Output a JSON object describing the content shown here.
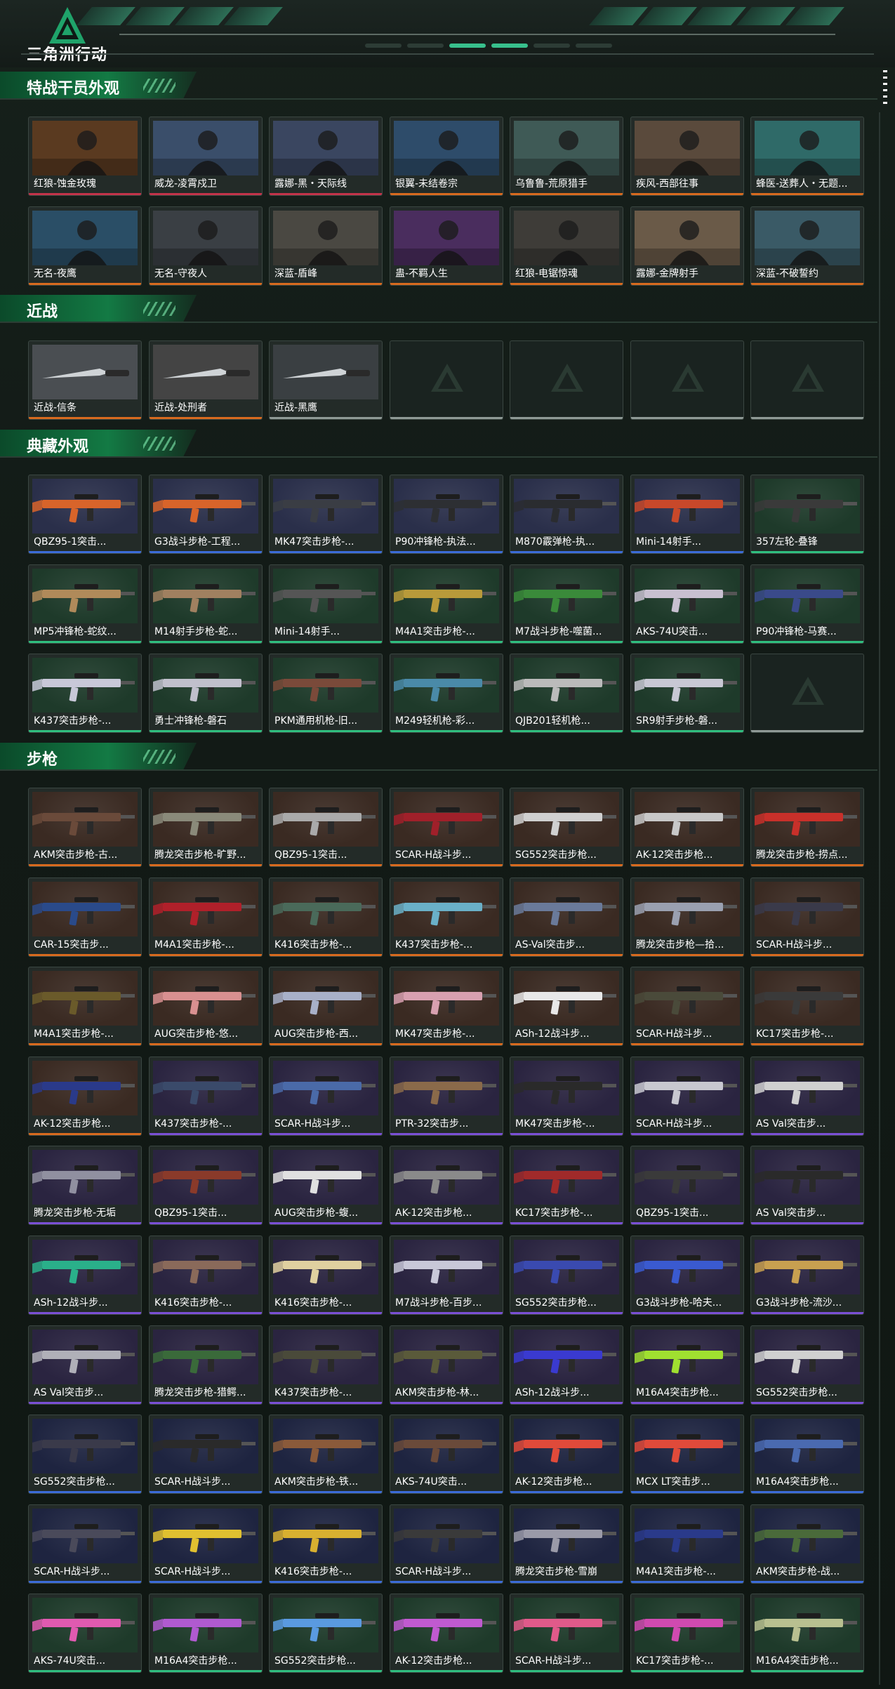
{
  "header": {
    "logo_text": "三角洲行动"
  },
  "colors": {
    "orange": "#d86a1e",
    "red": "#c2334a",
    "gray": "#8f9a96",
    "blue": "#3b6bd8",
    "green": "#2fbf7f",
    "purple": "#7a4fd6",
    "accent": "#1e8a4e"
  },
  "sections": [
    {
      "id": "operators",
      "title": "特战干员外观",
      "items": [
        {
          "name": "红狼-蚀金玫瑰",
          "rarity": "red",
          "tint": "#5a3a20"
        },
        {
          "name": "威龙-凌霄戍卫",
          "rarity": "red",
          "tint": "#3a4e6a"
        },
        {
          "name": "露娜-黑・天际线",
          "rarity": "red",
          "tint": "#3a4660"
        },
        {
          "name": "银翼-未结卷宗",
          "rarity": "orange",
          "tint": "#2e4c6a"
        },
        {
          "name": "乌鲁鲁-荒原猎手",
          "rarity": "orange",
          "tint": "#3f5a56"
        },
        {
          "name": "疾风-西部往事",
          "rarity": "orange",
          "tint": "#5a4a3c"
        },
        {
          "name": "蜂医-送葬人・无题...",
          "rarity": "orange",
          "tint": "#2f6a68"
        },
        {
          "name": "无名-夜鹰",
          "rarity": "orange",
          "tint": "#2a4e66"
        },
        {
          "name": "无名-守夜人",
          "rarity": "orange",
          "tint": "#3a3f44"
        },
        {
          "name": "深蓝-盾峰",
          "rarity": "orange",
          "tint": "#4a4842"
        },
        {
          "name": "蛊-不羁人生",
          "rarity": "orange",
          "tint": "#4a2d5e"
        },
        {
          "name": "红狼-电锯惊魂",
          "rarity": "orange",
          "tint": "#3e3c38"
        },
        {
          "name": "露娜-金牌射手",
          "rarity": "orange",
          "tint": "#6a5a48"
        },
        {
          "name": "深蓝-不破誓约",
          "rarity": "orange",
          "tint": "#3a5a66"
        }
      ]
    },
    {
      "id": "melee",
      "title": "近战",
      "items": [
        {
          "name": "近战-信条",
          "rarity": "orange",
          "tint": "#4a4e52"
        },
        {
          "name": "近战-处刑者",
          "rarity": "orange",
          "tint": "#444"
        },
        {
          "name": "近战-黑鹰",
          "rarity": "gray",
          "tint": "#3a3f42"
        },
        {
          "name": "",
          "rarity": "gray",
          "empty": true
        },
        {
          "name": "",
          "rarity": "gray",
          "empty": true
        },
        {
          "name": "",
          "rarity": "gray",
          "empty": true
        },
        {
          "name": "",
          "rarity": "gray",
          "empty": true
        }
      ]
    },
    {
      "id": "collection",
      "title": "典藏外观",
      "items": [
        {
          "name": "QBZ95-1突击...",
          "rarity": "blue",
          "gun": "#d8642a",
          "tint": "#2a2f4a"
        },
        {
          "name": "G3战斗步枪-工程...",
          "rarity": "blue",
          "gun": "#d8642a",
          "tint": "#2a2f4a"
        },
        {
          "name": "MK47突击步枪-...",
          "rarity": "blue",
          "gun": "#3a3d44",
          "tint": "#2a2f4a"
        },
        {
          "name": "P90冲锋枪-执法...",
          "rarity": "blue",
          "gun": "#2d2f33",
          "tint": "#2a2f4a"
        },
        {
          "name": "M870霰弹枪-执...",
          "rarity": "blue",
          "gun": "#2a2c30",
          "tint": "#2a2f4a"
        },
        {
          "name": "Mini-14射手...",
          "rarity": "blue",
          "gun": "#c8482a",
          "tint": "#2a2f4a"
        },
        {
          "name": "357左轮-叠锋",
          "rarity": "green",
          "gun": "#3a3a3a",
          "tint": "#1e3a2a"
        },
        {
          "name": "MP5冲锋枪-蛇纹...",
          "rarity": "green",
          "gun": "#b08a5a",
          "tint": "#1e3a2a"
        },
        {
          "name": "M14射手步枪-蛇...",
          "rarity": "green",
          "gun": "#a08060",
          "tint": "#1e3a2a"
        },
        {
          "name": "Mini-14射手...",
          "rarity": "green",
          "gun": "#555",
          "tint": "#1e3a2a"
        },
        {
          "name": "M4A1突击步枪-...",
          "rarity": "green",
          "gun": "#b89a3a",
          "tint": "#1e3a2a"
        },
        {
          "name": "M7战斗步枪-噬菌...",
          "rarity": "green",
          "gun": "#3a8a3a",
          "tint": "#1e3a2a"
        },
        {
          "name": "AKS-74U突击...",
          "rarity": "green",
          "gun": "#c8c0d0",
          "tint": "#1e3a2a"
        },
        {
          "name": "P90冲锋枪-马赛...",
          "rarity": "green",
          "gun": "#3a4a8a",
          "tint": "#1e3a2a"
        },
        {
          "name": "K437突击步枪-...",
          "rarity": "green",
          "gun": "#c8c8d8",
          "tint": "#1e3a2a"
        },
        {
          "name": "勇士冲锋枪-磐石",
          "rarity": "green",
          "gun": "#c0c0cc",
          "tint": "#1e3a2a"
        },
        {
          "name": "PKM通用机枪-旧...",
          "rarity": "green",
          "gun": "#7a4a3a",
          "tint": "#1e3a2a"
        },
        {
          "name": "M249轻机枪-彩...",
          "rarity": "green",
          "gun": "#4a8aa8",
          "tint": "#1e3a2a"
        },
        {
          "name": "QJB201轻机枪...",
          "rarity": "green",
          "gun": "#bbb",
          "tint": "#1e3a2a"
        },
        {
          "name": "SR9射手步枪-磐...",
          "rarity": "green",
          "gun": "#c8c8d4",
          "tint": "#1e3a2a"
        },
        {
          "name": "",
          "rarity": "gray",
          "empty": true
        }
      ]
    },
    {
      "id": "rifles",
      "title": "步枪",
      "items": [
        {
          "name": "AKM突击步枪-古...",
          "rarity": "orange",
          "gun": "#6a4a3a",
          "tint": "#3a2a22"
        },
        {
          "name": "腾龙突击步枪-旷野...",
          "rarity": "orange",
          "gun": "#8a8a7a",
          "tint": "#3a2a22"
        },
        {
          "name": "QBZ95-1突击...",
          "rarity": "orange",
          "gun": "#aaa",
          "tint": "#3a2a22"
        },
        {
          "name": "SCAR-H战斗步...",
          "rarity": "orange",
          "gun": "#a0202a",
          "tint": "#3a2a22"
        },
        {
          "name": "SG552突击步枪...",
          "rarity": "orange",
          "gun": "#d0d0d0",
          "tint": "#3a2a22"
        },
        {
          "name": "AK-12突击步枪...",
          "rarity": "orange",
          "gun": "#c8c8c8",
          "tint": "#3a2a22"
        },
        {
          "name": "腾龙突击步枪-捞点...",
          "rarity": "orange",
          "gun": "#c8302a",
          "tint": "#3a2a22"
        },
        {
          "name": "CAR-15突击步...",
          "rarity": "orange",
          "gun": "#2a4a8a",
          "tint": "#3a2a22"
        },
        {
          "name": "M4A1突击步枪-...",
          "rarity": "orange",
          "gun": "#b0202a",
          "tint": "#3a2a22"
        },
        {
          "name": "K416突击步枪-...",
          "rarity": "orange",
          "gun": "#4a6a5a",
          "tint": "#3a2a22"
        },
        {
          "name": "K437突击步枪-...",
          "rarity": "orange",
          "gun": "#6ab0c8",
          "tint": "#3a2a22"
        },
        {
          "name": "AS-Val突击步...",
          "rarity": "orange",
          "gun": "#6a7a9a",
          "tint": "#3a2a22"
        },
        {
          "name": "腾龙突击步枪—拾...",
          "rarity": "orange",
          "gun": "#9aa0b0",
          "tint": "#3a2a22"
        },
        {
          "name": "SCAR-H战斗步...",
          "rarity": "orange",
          "gun": "#3a3a4a",
          "tint": "#3a2a22"
        },
        {
          "name": "M4A1突击步枪-...",
          "rarity": "orange",
          "gun": "#6a5a2a",
          "tint": "#3a2a22"
        },
        {
          "name": "AUG突击步枪-悠...",
          "rarity": "orange",
          "gun": "#d89090",
          "tint": "#3a2a22"
        },
        {
          "name": "AUG突击步枪-西...",
          "rarity": "orange",
          "gun": "#a8b0c8",
          "tint": "#3a2a22"
        },
        {
          "name": "MK47突击步枪-...",
          "rarity": "orange",
          "gun": "#d8a0b0",
          "tint": "#3a2a22"
        },
        {
          "name": "ASh-12战斗步...",
          "rarity": "orange",
          "gun": "#e8e8e8",
          "tint": "#3a2a22"
        },
        {
          "name": "SCAR-H战斗步...",
          "rarity": "orange",
          "gun": "#4a4a3a",
          "tint": "#3a2a22"
        },
        {
          "name": "KC17突击步枪-...",
          "rarity": "orange",
          "gun": "#3a3a3a",
          "tint": "#3a2a22"
        },
        {
          "name": "AK-12突击步枪...",
          "rarity": "orange",
          "gun": "#2a3a8a",
          "tint": "#3a2a22"
        },
        {
          "name": "K437突击步枪-...",
          "rarity": "purple",
          "gun": "#3a4a6a",
          "tint": "#2a2440"
        },
        {
          "name": "SCAR-H战斗步...",
          "rarity": "purple",
          "gun": "#4a6aa8",
          "tint": "#2a2440"
        },
        {
          "name": "PTR-32突击步...",
          "rarity": "purple",
          "gun": "#8a6a4a",
          "tint": "#2a2440"
        },
        {
          "name": "MK47突击步枪-...",
          "rarity": "purple",
          "gun": "#2a2a2a",
          "tint": "#2a2440"
        },
        {
          "name": "SCAR-H战斗步...",
          "rarity": "purple",
          "gun": "#c8c8d0",
          "tint": "#2a2440"
        },
        {
          "name": "AS Val突击步...",
          "rarity": "purple",
          "gun": "#d0d0d0",
          "tint": "#2a2440"
        },
        {
          "name": "腾龙突击步枪-无垢",
          "rarity": "purple",
          "gun": "#9090a0",
          "tint": "#2a2440"
        },
        {
          "name": "QBZ95-1突击...",
          "rarity": "purple",
          "gun": "#8a3a2a",
          "tint": "#2a2440"
        },
        {
          "name": "AUG突击步枪-蝮...",
          "rarity": "purple",
          "gun": "#e0e0e0",
          "tint": "#2a2440"
        },
        {
          "name": "AK-12突击步枪...",
          "rarity": "purple",
          "gun": "#8a8a8a",
          "tint": "#2a2440"
        },
        {
          "name": "KC17突击步枪-...",
          "rarity": "purple",
          "gun": "#a02a2a",
          "tint": "#2a2440"
        },
        {
          "name": "QBZ95-1突击...",
          "rarity": "purple",
          "gun": "#3a3a3a",
          "tint": "#2a2440"
        },
        {
          "name": "AS Val突击步...",
          "rarity": "purple",
          "gun": "#2a2a2a",
          "tint": "#2a2440"
        },
        {
          "name": "ASh-12战斗步...",
          "rarity": "purple",
          "gun": "#2ab08a",
          "tint": "#2a2440"
        },
        {
          "name": "K416突击步枪-...",
          "rarity": "purple",
          "gun": "#8a6a5a",
          "tint": "#2a2440"
        },
        {
          "name": "K416突击步枪-...",
          "rarity": "purple",
          "gun": "#e0d0a0",
          "tint": "#2a2440"
        },
        {
          "name": "M7战斗步枪-百步...",
          "rarity": "purple",
          "gun": "#c8c8d8",
          "tint": "#2a2440"
        },
        {
          "name": "SG552突击步枪...",
          "rarity": "purple",
          "gun": "#3a4ab0",
          "tint": "#2a2440"
        },
        {
          "name": "G3战斗步枪-哈夫...",
          "rarity": "purple",
          "gun": "#3a5ad0",
          "tint": "#2a2440"
        },
        {
          "name": "G3战斗步枪-流沙...",
          "rarity": "purple",
          "gun": "#c8a050",
          "tint": "#2a2440"
        },
        {
          "name": "AS Val突击步...",
          "rarity": "purple",
          "gun": "#b0b0b8",
          "tint": "#2a2440"
        },
        {
          "name": "腾龙突击步枪-猎鳄...",
          "rarity": "purple",
          "gun": "#3a6a3a",
          "tint": "#2a2440"
        },
        {
          "name": "K437突击步枪-...",
          "rarity": "purple",
          "gun": "#4a4a3a",
          "tint": "#2a2440"
        },
        {
          "name": "AKM突击步枪-林...",
          "rarity": "purple",
          "gun": "#5a5a3a",
          "tint": "#2a2440"
        },
        {
          "name": "ASh-12战斗步...",
          "rarity": "purple",
          "gun": "#3a3ad0",
          "tint": "#2a2440"
        },
        {
          "name": "M16A4突击步枪...",
          "rarity": "purple",
          "gun": "#a0e030",
          "tint": "#2a2440"
        },
        {
          "name": "SG552突击步枪...",
          "rarity": "purple",
          "gun": "#d0d0d0",
          "tint": "#2a2440"
        },
        {
          "name": "SG552突击步枪...",
          "rarity": "blue",
          "gun": "#3a3a4a",
          "tint": "#1e2440"
        },
        {
          "name": "SCAR-H战斗步...",
          "rarity": "blue",
          "gun": "#2a2a2a",
          "tint": "#1e2440"
        },
        {
          "name": "AKM突击步枪-铁...",
          "rarity": "blue",
          "gun": "#8a5a3a",
          "tint": "#1e2440"
        },
        {
          "name": "AKS-74U突击...",
          "rarity": "blue",
          "gun": "#6a4a3a",
          "tint": "#1e2440"
        },
        {
          "name": "AK-12突击步枪...",
          "rarity": "blue",
          "gun": "#e04a3a",
          "tint": "#1e2440"
        },
        {
          "name": "MCX LT突击步...",
          "rarity": "blue",
          "gun": "#e04a3a",
          "tint": "#1e2440"
        },
        {
          "name": "M16A4突击步枪...",
          "rarity": "blue",
          "gun": "#4a6ab0",
          "tint": "#1e2440"
        },
        {
          "name": "SCAR-H战斗步...",
          "rarity": "blue",
          "gun": "#4a4a5a",
          "tint": "#1e2440"
        },
        {
          "name": "SCAR-H战斗步...",
          "rarity": "blue",
          "gun": "#e0c030",
          "tint": "#1e2440"
        },
        {
          "name": "K416突击步枪-...",
          "rarity": "blue",
          "gun": "#d8b030",
          "tint": "#1e2440"
        },
        {
          "name": "SCAR-H战斗步...",
          "rarity": "blue",
          "gun": "#3a3a3a",
          "tint": "#1e2440"
        },
        {
          "name": "腾龙突击步枪-雪崩",
          "rarity": "blue",
          "gun": "#9a9aa8",
          "tint": "#1e2440"
        },
        {
          "name": "M4A1突击步枪-...",
          "rarity": "blue",
          "gun": "#2a3a8a",
          "tint": "#1e2440"
        },
        {
          "name": "AKM突击步枪-战...",
          "rarity": "blue",
          "gun": "#4a6a3a",
          "tint": "#1e2440"
        },
        {
          "name": "AKS-74U突击...",
          "rarity": "green",
          "gun": "#e05ab0",
          "tint": "#1e3a2a"
        },
        {
          "name": "M16A4突击步枪...",
          "rarity": "green",
          "gun": "#b05ad0",
          "tint": "#1e3a2a"
        },
        {
          "name": "SG552突击步枪...",
          "rarity": "green",
          "gun": "#5a9ae0",
          "tint": "#1e3a2a"
        },
        {
          "name": "AK-12突击步枪...",
          "rarity": "green",
          "gun": "#c05ad0",
          "tint": "#1e3a2a"
        },
        {
          "name": "SCAR-H战斗步...",
          "rarity": "green",
          "gun": "#e05a8a",
          "tint": "#1e3a2a"
        },
        {
          "name": "KC17突击步枪-...",
          "rarity": "green",
          "gun": "#d04ab0",
          "tint": "#1e3a2a"
        },
        {
          "name": "M16A4突击步枪...",
          "rarity": "green",
          "gun": "#b8c090",
          "tint": "#1e3a2a"
        }
      ]
    }
  ]
}
